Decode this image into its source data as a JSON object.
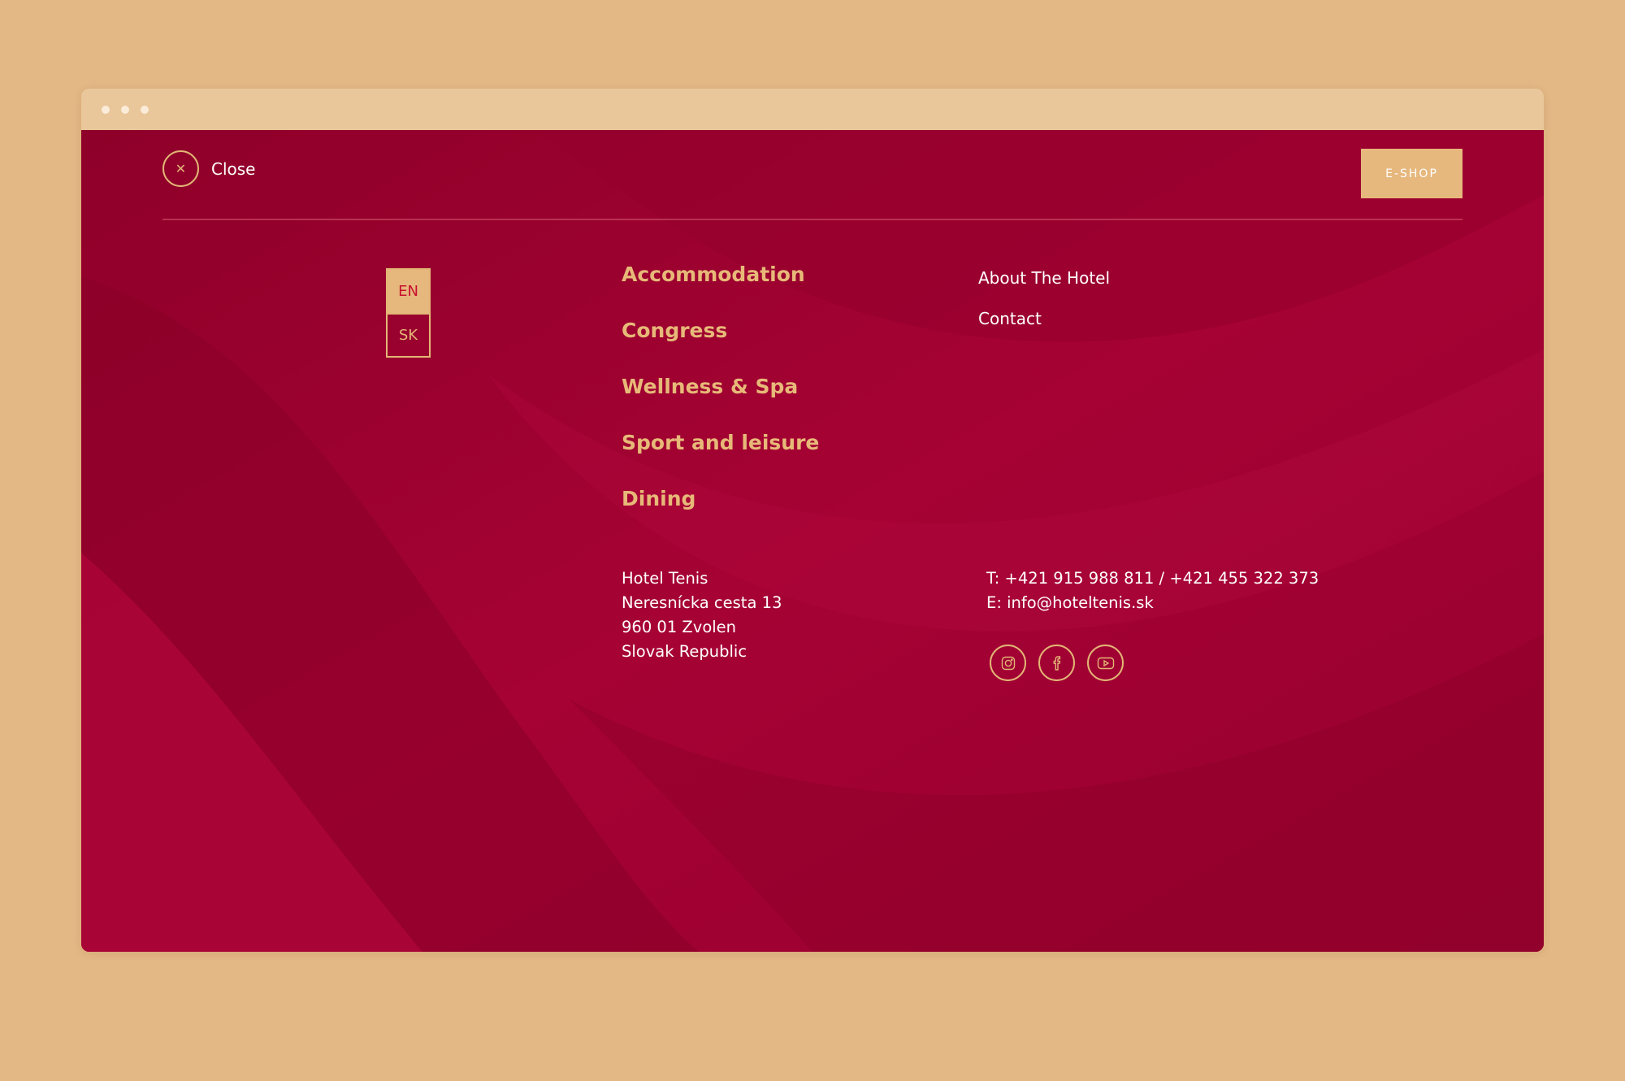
{
  "header": {
    "close_label": "Close",
    "eshop_label": "E-SHOP"
  },
  "languages": [
    "EN",
    "SK"
  ],
  "active_language": "EN",
  "main_nav": [
    "Accommodation",
    "Congress",
    "Wellness & Spa",
    "Sport and leisure",
    "Dining"
  ],
  "secondary_nav": [
    "About The Hotel",
    "Contact"
  ],
  "address": {
    "name": "Hotel Tenis",
    "street": "Neresnícka cesta 13",
    "city": "960 01 Zvolen",
    "country": "Slovak Republic"
  },
  "contact": {
    "phone_prefix": "T:",
    "phone": "+421 915 988 811 / +421 455 322 373",
    "email_prefix": "E:",
    "email": "info@hoteltenis.sk"
  },
  "social": [
    "instagram-icon",
    "facebook-icon",
    "youtube-icon"
  ],
  "colors": {
    "background": "#e3b885",
    "page_red": "#a10233",
    "gold": "#e6b87e",
    "gold_text": "#e7b978"
  }
}
